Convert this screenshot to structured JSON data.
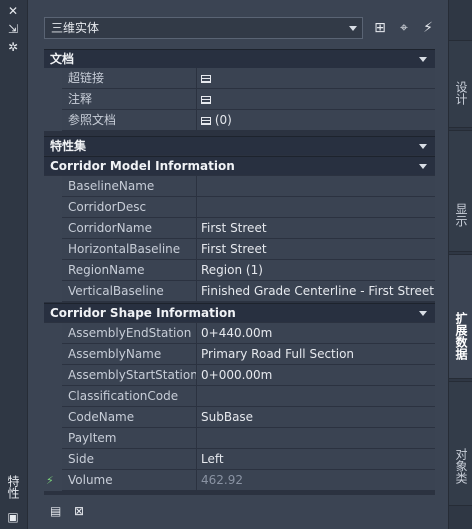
{
  "palette": {
    "title": "特性"
  },
  "selector": {
    "value": "三维实体"
  },
  "sections": [
    {
      "title": "文档",
      "rows": [
        {
          "name": "超链接",
          "value": "",
          "icon": "table-icon"
        },
        {
          "name": "注释",
          "value": "",
          "icon": "table-icon"
        },
        {
          "name": "参照文档",
          "value": "(0)",
          "icon": "table-icon"
        }
      ]
    },
    {
      "title": "特性集",
      "rows": []
    },
    {
      "title": "Corridor Model Information",
      "rows": [
        {
          "name": "BaselineName",
          "value": ""
        },
        {
          "name": "CorridorDesc",
          "value": ""
        },
        {
          "name": "CorridorName",
          "value": "First Street"
        },
        {
          "name": "HorizontalBaseline",
          "value": "First Street"
        },
        {
          "name": "RegionName",
          "value": "Region (1)"
        },
        {
          "name": "VerticalBaseline",
          "value": "Finished Grade Centerline - First Street"
        }
      ]
    },
    {
      "title": "Corridor Shape Information",
      "rows": [
        {
          "name": "AssemblyEndStation",
          "value": "0+440.00m"
        },
        {
          "name": "AssemblyName",
          "value": "Primary Road Full Section"
        },
        {
          "name": "AssemblyStartStation",
          "value": "0+000.00m"
        },
        {
          "name": "ClassificationCode",
          "value": ""
        },
        {
          "name": "CodeName",
          "value": "SubBase"
        },
        {
          "name": "PayItem",
          "value": ""
        },
        {
          "name": "Side",
          "value": "Left"
        },
        {
          "name": "Volume",
          "value": "462.92"
        }
      ]
    }
  ],
  "tabs": [
    {
      "label": "设计"
    },
    {
      "label": "显示"
    },
    {
      "label": "扩展数据"
    },
    {
      "label": "对象类"
    }
  ]
}
